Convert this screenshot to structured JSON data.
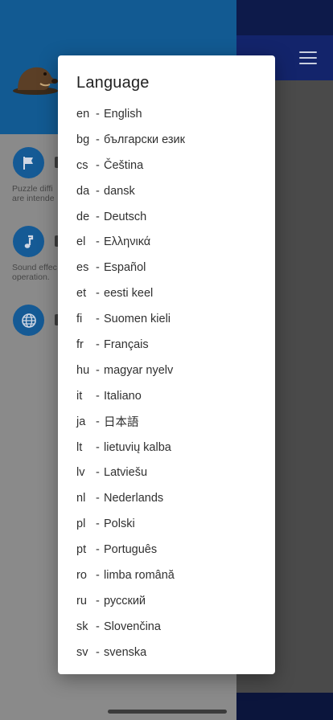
{
  "dialog": {
    "title": "Language",
    "items": [
      {
        "code": "en",
        "name": "English"
      },
      {
        "code": "bg",
        "name": "български език"
      },
      {
        "code": "cs",
        "name": "Čeština"
      },
      {
        "code": "da",
        "name": "dansk"
      },
      {
        "code": "de",
        "name": "Deutsch"
      },
      {
        "code": "el",
        "name": "Ελληνικά"
      },
      {
        "code": "es",
        "name": "Español"
      },
      {
        "code": "et",
        "name": "eesti keel"
      },
      {
        "code": "fi",
        "name": "Suomen kieli"
      },
      {
        "code": "fr",
        "name": "Français"
      },
      {
        "code": "hu",
        "name": "magyar nyelv"
      },
      {
        "code": "it",
        "name": "Italiano"
      },
      {
        "code": "ja",
        "name": "日本語"
      },
      {
        "code": "lt",
        "name": "lietuvių kalba"
      },
      {
        "code": "lv",
        "name": "Latviešu"
      },
      {
        "code": "nl",
        "name": "Nederlands"
      },
      {
        "code": "pl",
        "name": "Polski"
      },
      {
        "code": "pt",
        "name": "Português"
      },
      {
        "code": "ro",
        "name": "limba română"
      },
      {
        "code": "ru",
        "name": "русский"
      },
      {
        "code": "sk",
        "name": "Slovenčina"
      },
      {
        "code": "sv",
        "name": "svenska"
      }
    ],
    "separator": "-"
  },
  "drawer": {
    "settings": [
      {
        "icon": "flag-icon",
        "description_lines": [
          "Puzzle diffi",
          "are intende"
        ]
      },
      {
        "icon": "music-note-icon",
        "description_lines": [
          "Sound effec",
          "operation."
        ]
      },
      {
        "icon": "globe-icon",
        "description_lines": []
      }
    ]
  },
  "colors": {
    "drawer_header": "#125a92",
    "icon_circle": "#155a95",
    "app_bar": "#13246b",
    "dialog_bg": "#ffffff"
  }
}
